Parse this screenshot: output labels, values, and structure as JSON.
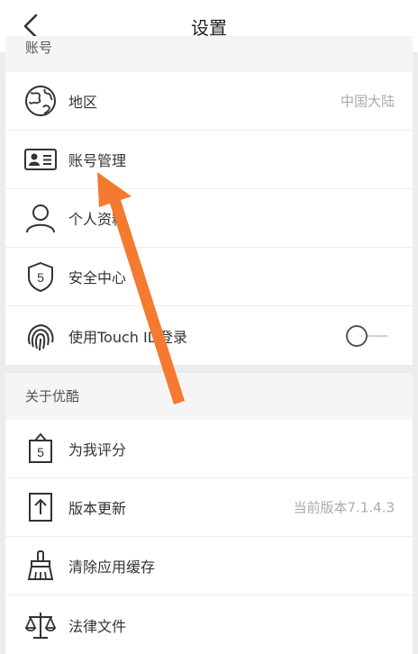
{
  "header": {
    "title": "设置"
  },
  "sections": {
    "account": {
      "title": "账号",
      "items": [
        {
          "label": "地区",
          "value": "中国大陆",
          "icon": "globe-icon"
        },
        {
          "label": "账号管理",
          "icon": "id-card-icon"
        },
        {
          "label": "个人资料",
          "icon": "person-icon"
        },
        {
          "label": "安全中心",
          "icon": "shield-icon"
        },
        {
          "label": "使用Touch ID登录",
          "icon": "fingerprint-icon",
          "toggle": false
        }
      ]
    },
    "about": {
      "title": "关于优酷",
      "items": [
        {
          "label": "为我评分",
          "icon": "rating-bag-icon"
        },
        {
          "label": "版本更新",
          "value": "当前版本7.1.4.3",
          "icon": "upload-icon"
        },
        {
          "label": "清除应用缓存",
          "icon": "broom-icon"
        },
        {
          "label": "法律文件",
          "icon": "scales-icon"
        }
      ]
    }
  },
  "colors": {
    "annotation_arrow": "#f47a2f"
  }
}
